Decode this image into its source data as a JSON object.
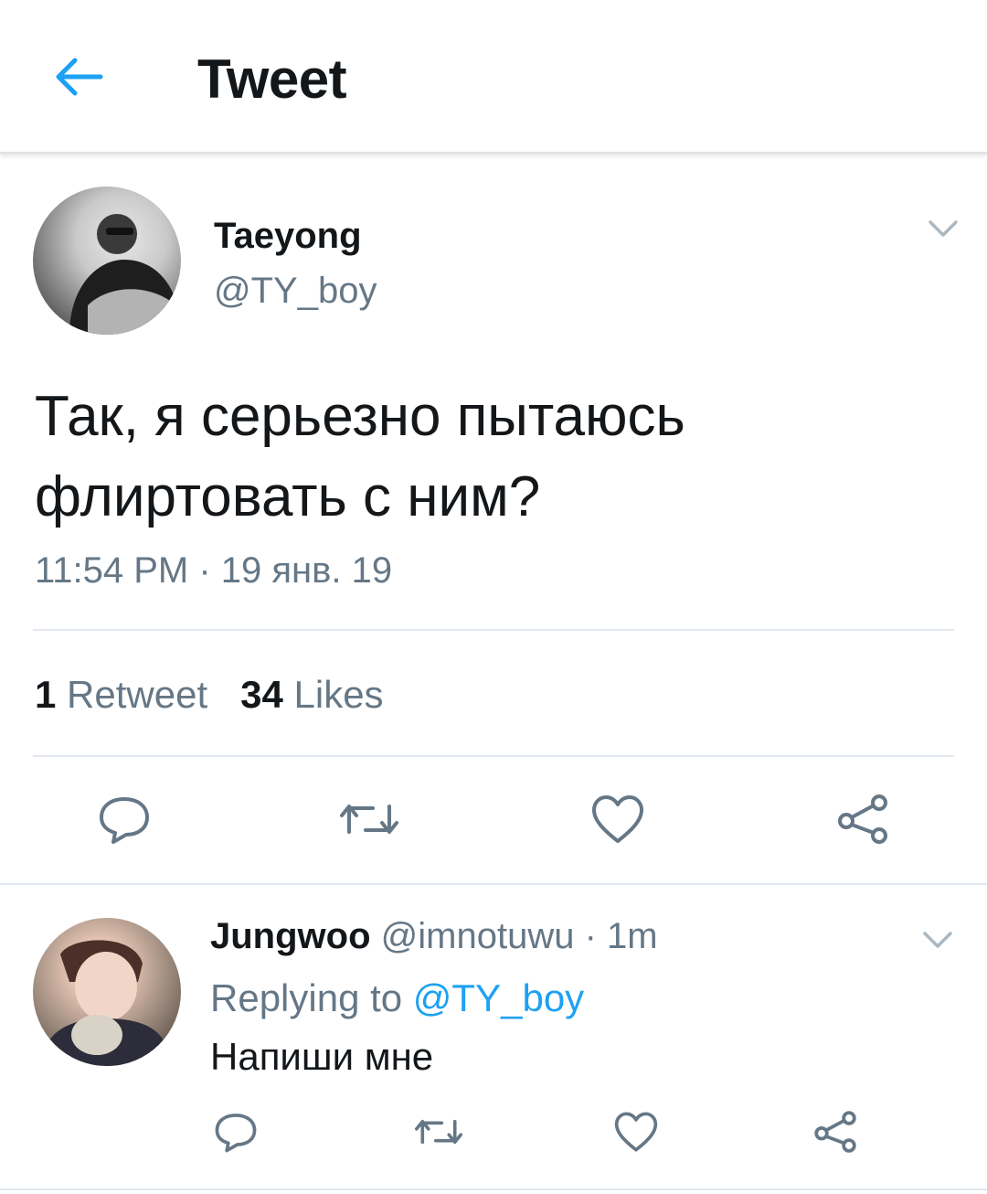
{
  "header": {
    "title": "Tweet",
    "back_icon": "arrow-left-icon"
  },
  "tweet": {
    "display_name": "Taeyong",
    "handle": "@TY_boy",
    "text_line1": "Так, я серьезно пытаюсь",
    "text_line2": "флиртовать с ним?",
    "timestamp": "11:54 PM · 19 янв. 19",
    "retweets_count": "1",
    "retweets_label": "Retweet",
    "likes_count": "34",
    "likes_label": "Likes",
    "actions": [
      "reply-icon",
      "retweet-icon",
      "like-icon",
      "share-icon"
    ]
  },
  "reply": {
    "display_name": "Jungwoo",
    "handle": "@imnotuwu",
    "time": "· 1m",
    "replying_label": "Replying to",
    "replying_mention": "@TY_boy",
    "text": "Напиши мне",
    "actions": [
      "reply-icon",
      "retweet-icon",
      "like-icon",
      "share-icon"
    ]
  },
  "colors": {
    "accent": "#1da1f2",
    "secondary_text": "#657786",
    "primary_text": "#14171a",
    "divider": "#e1e8ed"
  }
}
